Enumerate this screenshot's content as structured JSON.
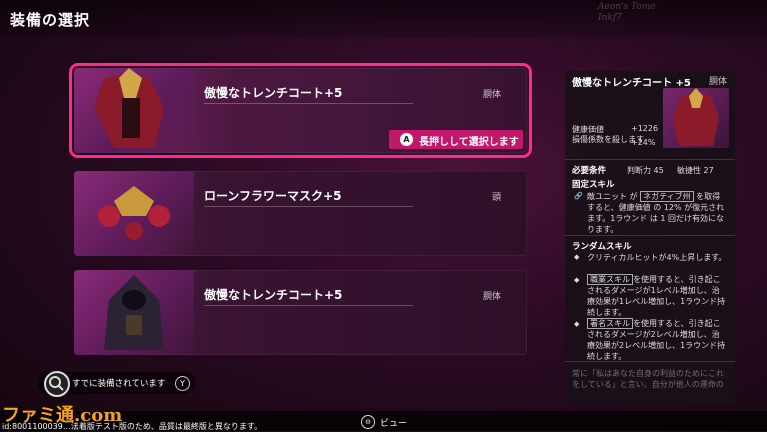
{
  "header": {
    "title": "装備の選択",
    "scribble": "Aeon's Tome\nInkf7"
  },
  "items": [
    {
      "name": "傲慢なトレンチコート+5",
      "slot": "胴体",
      "selected": true
    },
    {
      "name": "ローンフラワーマスク+5",
      "slot": "頭",
      "selected": false
    },
    {
      "name": "傲慢なトレンチコート+5",
      "slot": "胴体",
      "selected": false
    }
  ],
  "hold_button": {
    "key": "A",
    "label": "長押しして選択します"
  },
  "detail": {
    "name": "傲慢なトレンチコート +5",
    "slot": "胴体",
    "stats": [
      {
        "label": "健康価値",
        "value": "+1226"
      },
      {
        "label": "損傷係数を殺します",
        "value": "+24%"
      }
    ],
    "requirements": {
      "label": "必要条件",
      "judgment": "判断力 45",
      "agility": "敏捷性 27"
    },
    "fixed_skill": {
      "title": "固定スキル",
      "pre": "敵ユニット が ",
      "boxed": "ネガティブ州",
      "post": " を取得すると、健康価値 の 12% が復元されます。1ラウンド は 1 回だけ有効になります。"
    },
    "random_skill": {
      "title": "ランダムスキル",
      "entries": [
        {
          "pre": "クリティカルヒットが4%上昇します。",
          "boxed": "",
          "post": ""
        },
        {
          "pre": "",
          "boxed": "職業スキル",
          "post": "を使用すると、引き起こされるダメージが1レベル増加し、治療効果が1レベル増加し、1ラウンド持続します。"
        },
        {
          "pre": "",
          "boxed": "署名スキル",
          "post": "を使用すると、引き起こされるダメージが2レベル増加し、治療効果が2レベル増加し、1ラウンド持続します。"
        }
      ]
    },
    "flavor": "常に「私はあなた自身の利益のためにこれをしている」と言い、自分が他人の運命の"
  },
  "already_equipped": {
    "label": "すでに装備されています",
    "key": "Y"
  },
  "bottom": {
    "view_label": "ビュー",
    "view_key": "⊖"
  },
  "footer_note": "id:8001100039…法着版テスト版のため、品質は最終版と異なります。",
  "logo": "ファミ通.com",
  "colors": {
    "accent": "#ff2a8a",
    "button": "#c2186b"
  }
}
